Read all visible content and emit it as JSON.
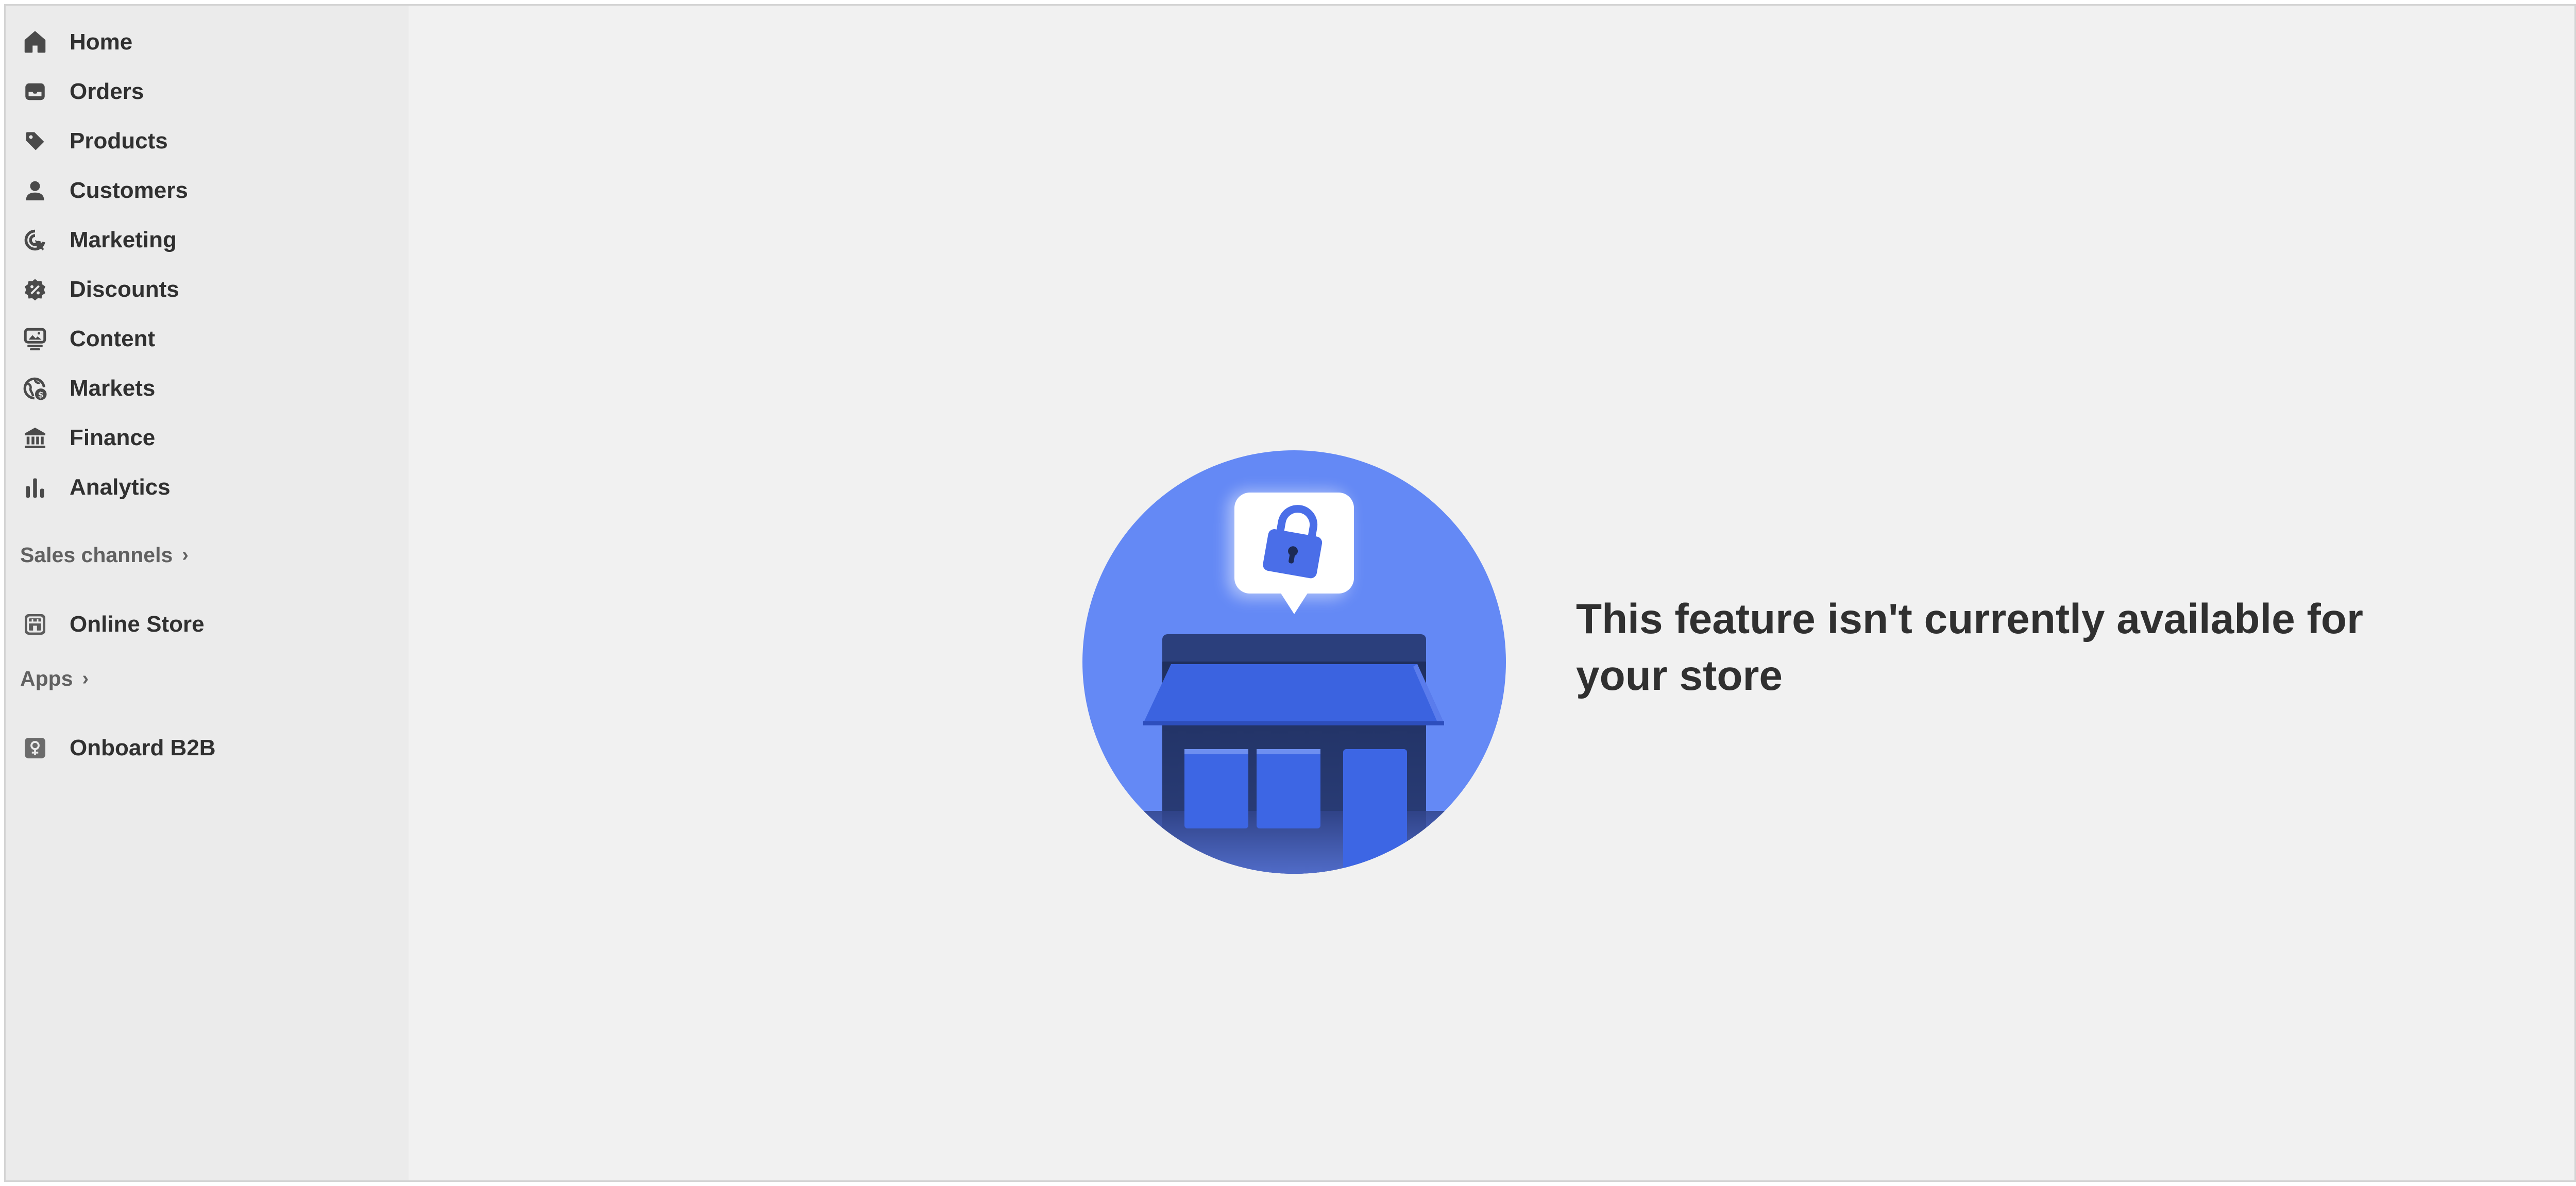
{
  "sidebar": {
    "items": [
      {
        "label": "Home",
        "icon": "home-icon"
      },
      {
        "label": "Orders",
        "icon": "inbox-icon"
      },
      {
        "label": "Products",
        "icon": "tag-icon"
      },
      {
        "label": "Customers",
        "icon": "person-icon"
      },
      {
        "label": "Marketing",
        "icon": "target-icon"
      },
      {
        "label": "Discounts",
        "icon": "discount-badge-icon"
      },
      {
        "label": "Content",
        "icon": "content-icon"
      },
      {
        "label": "Markets",
        "icon": "globe-icon"
      },
      {
        "label": "Finance",
        "icon": "bank-icon"
      },
      {
        "label": "Analytics",
        "icon": "bar-chart-icon"
      }
    ],
    "sales_channels": {
      "heading": "Sales channels",
      "chevron": "›",
      "items": [
        {
          "label": "Online Store",
          "icon": "storefront-icon"
        }
      ]
    },
    "apps": {
      "heading": "Apps",
      "chevron": "›",
      "items": [
        {
          "label": "Onboard B2B",
          "icon": "app-icon"
        }
      ]
    }
  },
  "main": {
    "illustration": "store-locked-illustration",
    "message": "This feature isn't currently available for your store"
  },
  "colors": {
    "sidebar_bg": "#ebebeb",
    "main_bg": "#f1f1f1",
    "text": "#303030",
    "muted_text": "#616161",
    "illustration_blue": "#6489f5",
    "store_blue": "#3d66e4",
    "store_dark": "#263a73"
  }
}
